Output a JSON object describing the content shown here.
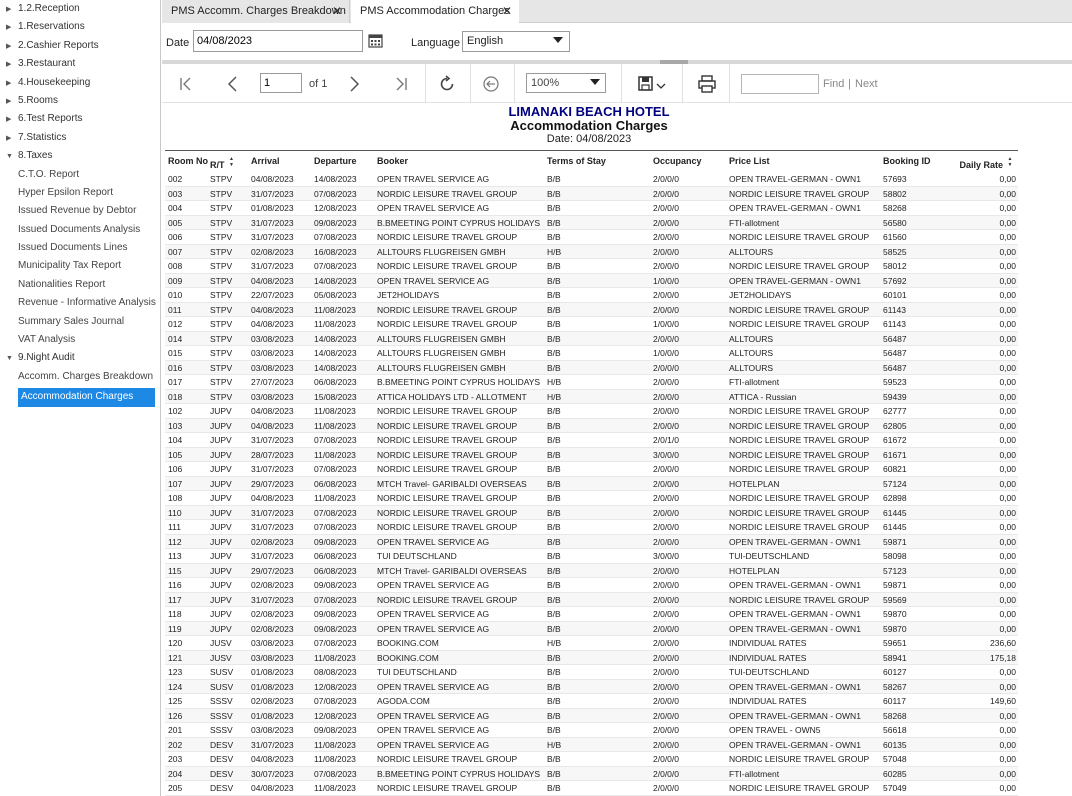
{
  "sidebar": {
    "items": [
      {
        "label": "1.2.Reception",
        "type": "section"
      },
      {
        "label": "1.Reservations",
        "type": "section"
      },
      {
        "label": "2.Cashier Reports",
        "type": "section"
      },
      {
        "label": "3.Restaurant",
        "type": "section"
      },
      {
        "label": "4.Housekeeping",
        "type": "section"
      },
      {
        "label": "5.Rooms",
        "type": "section"
      },
      {
        "label": "6.Test Reports",
        "type": "section"
      },
      {
        "label": "7.Statistics",
        "type": "section"
      },
      {
        "label": "8.Taxes",
        "type": "section-open"
      },
      {
        "label": "C.T.O. Report",
        "type": "child"
      },
      {
        "label": "Hyper Epsilon Report",
        "type": "child"
      },
      {
        "label": "Issued Revenue by Debtor",
        "type": "child"
      },
      {
        "label": "Issued Documents Analysis",
        "type": "child"
      },
      {
        "label": "Issued Documents Lines",
        "type": "child"
      },
      {
        "label": "Municipality Tax Report",
        "type": "child"
      },
      {
        "label": "Nationalities Report",
        "type": "child"
      },
      {
        "label": "Revenue - Informative Analysis",
        "type": "child"
      },
      {
        "label": "Summary Sales Journal",
        "type": "child"
      },
      {
        "label": "VAT Analysis",
        "type": "child"
      },
      {
        "label": "9.Night Audit",
        "type": "section-open"
      },
      {
        "label": "Accomm. Charges Breakdown",
        "type": "child"
      },
      {
        "label": "Accommodation Charges",
        "type": "active"
      }
    ]
  },
  "tabs": [
    {
      "label": "PMS Accomm. Charges Breakdown",
      "close": "✕"
    },
    {
      "label": "PMS Accommodation Charges",
      "close": "✕"
    }
  ],
  "filters": {
    "date_label": "Date",
    "date_value": "04/08/2023",
    "language_label": "Language",
    "language_value": "English"
  },
  "toolbar": {
    "page_value": "1",
    "of_label": "of 1",
    "zoom": "100%",
    "find_label": "Find",
    "separator": "|",
    "next_label": "Next"
  },
  "icons": [
    "first-page-icon",
    "prev-page-icon",
    "next-page-icon",
    "last-page-icon",
    "refresh-icon",
    "back-icon",
    "save-icon",
    "print-icon",
    "calendar-icon"
  ],
  "report": {
    "hotel_name": "LIMANAKI BEACH HOTEL",
    "title": "Accommodation Charges",
    "date_line": "Date: 04/08/2023",
    "columns": [
      "Room No",
      "R/T",
      "Arrival",
      "Departure",
      "Booker",
      "Terms of Stay",
      "Occupancy",
      "Price List",
      "Booking ID",
      "Daily Rate"
    ],
    "rows": [
      [
        "002",
        "STPV",
        "04/08/2023",
        "14/08/2023",
        "OPEN TRAVEL SERVICE AG",
        "B/B",
        "2/0/0/0",
        "OPEN TRAVEL-GERMAN - OWN1",
        "57693",
        "0,00"
      ],
      [
        "003",
        "STPV",
        "31/07/2023",
        "07/08/2023",
        "NORDIC LEISURE TRAVEL GROUP",
        "B/B",
        "2/0/0/0",
        "NORDIC LEISURE TRAVEL GROUP",
        "58802",
        "0,00"
      ],
      [
        "004",
        "STPV",
        "01/08/2023",
        "12/08/2023",
        "OPEN TRAVEL SERVICE AG",
        "B/B",
        "2/0/0/0",
        "OPEN TRAVEL-GERMAN - OWN1",
        "58268",
        "0,00"
      ],
      [
        "005",
        "STPV",
        "31/07/2023",
        "09/08/2023",
        "B.BMEETING POINT CYPRUS HOLIDAYS",
        "B/B",
        "2/0/0/0",
        "FTI-allotment",
        "56580",
        "0,00"
      ],
      [
        "006",
        "STPV",
        "31/07/2023",
        "07/08/2023",
        "NORDIC LEISURE TRAVEL GROUP",
        "B/B",
        "2/0/0/0",
        "NORDIC LEISURE TRAVEL GROUP",
        "61560",
        "0,00"
      ],
      [
        "007",
        "STPV",
        "02/08/2023",
        "16/08/2023",
        "ALLTOURS FLUGREISEN GMBH",
        "H/B",
        "2/0/0/0",
        "ALLTOURS",
        "58525",
        "0,00"
      ],
      [
        "008",
        "STPV",
        "31/07/2023",
        "07/08/2023",
        "NORDIC LEISURE TRAVEL GROUP",
        "B/B",
        "2/0/0/0",
        "NORDIC LEISURE TRAVEL GROUP",
        "58012",
        "0,00"
      ],
      [
        "009",
        "STPV",
        "04/08/2023",
        "14/08/2023",
        "OPEN TRAVEL SERVICE AG",
        "B/B",
        "1/0/0/0",
        "OPEN TRAVEL-GERMAN - OWN1",
        "57692",
        "0,00"
      ],
      [
        "010",
        "STPV",
        "22/07/2023",
        "05/08/2023",
        "JET2HOLIDAYS",
        "B/B",
        "2/0/0/0",
        "JET2HOLIDAYS",
        "60101",
        "0,00"
      ],
      [
        "011",
        "STPV",
        "04/08/2023",
        "11/08/2023",
        "NORDIC LEISURE TRAVEL GROUP",
        "B/B",
        "2/0/0/0",
        "NORDIC LEISURE TRAVEL GROUP",
        "61143",
        "0,00"
      ],
      [
        "012",
        "STPV",
        "04/08/2023",
        "11/08/2023",
        "NORDIC LEISURE TRAVEL GROUP",
        "B/B",
        "1/0/0/0",
        "NORDIC LEISURE TRAVEL GROUP",
        "61143",
        "0,00"
      ],
      [
        "014",
        "STPV",
        "03/08/2023",
        "14/08/2023",
        "ALLTOURS FLUGREISEN GMBH",
        "B/B",
        "2/0/0/0",
        "ALLTOURS",
        "56487",
        "0,00"
      ],
      [
        "015",
        "STPV",
        "03/08/2023",
        "14/08/2023",
        "ALLTOURS FLUGREISEN GMBH",
        "B/B",
        "1/0/0/0",
        "ALLTOURS",
        "56487",
        "0,00"
      ],
      [
        "016",
        "STPV",
        "03/08/2023",
        "14/08/2023",
        "ALLTOURS FLUGREISEN GMBH",
        "B/B",
        "2/0/0/0",
        "ALLTOURS",
        "56487",
        "0,00"
      ],
      [
        "017",
        "STPV",
        "27/07/2023",
        "06/08/2023",
        "B.BMEETING POINT CYPRUS HOLIDAYS",
        "H/B",
        "2/0/0/0",
        "FTI-allotment",
        "59523",
        "0,00"
      ],
      [
        "018",
        "STPV",
        "03/08/2023",
        "15/08/2023",
        "ATTICA HOLIDAYS LTD - ALLOTMENT",
        "H/B",
        "2/0/0/0",
        "ATTICA - Russian",
        "59439",
        "0,00"
      ],
      [
        "102",
        "JUPV",
        "04/08/2023",
        "11/08/2023",
        "NORDIC LEISURE TRAVEL GROUP",
        "B/B",
        "2/0/0/0",
        "NORDIC LEISURE TRAVEL GROUP",
        "62777",
        "0,00"
      ],
      [
        "103",
        "JUPV",
        "04/08/2023",
        "11/08/2023",
        "NORDIC LEISURE TRAVEL GROUP",
        "B/B",
        "2/0/0/0",
        "NORDIC LEISURE TRAVEL GROUP",
        "62805",
        "0,00"
      ],
      [
        "104",
        "JUPV",
        "31/07/2023",
        "07/08/2023",
        "NORDIC LEISURE TRAVEL GROUP",
        "B/B",
        "2/0/1/0",
        "NORDIC LEISURE TRAVEL GROUP",
        "61672",
        "0,00"
      ],
      [
        "105",
        "JUPV",
        "28/07/2023",
        "11/08/2023",
        "NORDIC LEISURE TRAVEL GROUP",
        "B/B",
        "3/0/0/0",
        "NORDIC LEISURE TRAVEL GROUP",
        "61671",
        "0,00"
      ],
      [
        "106",
        "JUPV",
        "31/07/2023",
        "07/08/2023",
        "NORDIC LEISURE TRAVEL GROUP",
        "B/B",
        "2/0/0/0",
        "NORDIC LEISURE TRAVEL GROUP",
        "60821",
        "0,00"
      ],
      [
        "107",
        "JUPV",
        "29/07/2023",
        "06/08/2023",
        "MTCH Travel- GARIBALDI OVERSEAS",
        "B/B",
        "2/0/0/0",
        "HOTELPLAN",
        "57124",
        "0,00"
      ],
      [
        "108",
        "JUPV",
        "04/08/2023",
        "11/08/2023",
        "NORDIC LEISURE TRAVEL GROUP",
        "B/B",
        "2/0/0/0",
        "NORDIC LEISURE TRAVEL GROUP",
        "62898",
        "0,00"
      ],
      [
        "110",
        "JUPV",
        "31/07/2023",
        "07/08/2023",
        "NORDIC LEISURE TRAVEL GROUP",
        "B/B",
        "2/0/0/0",
        "NORDIC LEISURE TRAVEL GROUP",
        "61445",
        "0,00"
      ],
      [
        "111",
        "JUPV",
        "31/07/2023",
        "07/08/2023",
        "NORDIC LEISURE TRAVEL GROUP",
        "B/B",
        "2/0/0/0",
        "NORDIC LEISURE TRAVEL GROUP",
        "61445",
        "0,00"
      ],
      [
        "112",
        "JUPV",
        "02/08/2023",
        "09/08/2023",
        "OPEN TRAVEL SERVICE AG",
        "B/B",
        "2/0/0/0",
        "OPEN TRAVEL-GERMAN - OWN1",
        "59871",
        "0,00"
      ],
      [
        "113",
        "JUPV",
        "31/07/2023",
        "06/08/2023",
        "TUI DEUTSCHLAND",
        "B/B",
        "3/0/0/0",
        "TUI-DEUTSCHLAND",
        "58098",
        "0,00"
      ],
      [
        "115",
        "JUPV",
        "29/07/2023",
        "06/08/2023",
        "MTCH Travel- GARIBALDI OVERSEAS",
        "B/B",
        "2/0/0/0",
        "HOTELPLAN",
        "57123",
        "0,00"
      ],
      [
        "116",
        "JUPV",
        "02/08/2023",
        "09/08/2023",
        "OPEN TRAVEL SERVICE AG",
        "B/B",
        "2/0/0/0",
        "OPEN TRAVEL-GERMAN - OWN1",
        "59871",
        "0,00"
      ],
      [
        "117",
        "JUPV",
        "31/07/2023",
        "07/08/2023",
        "NORDIC LEISURE TRAVEL GROUP",
        "B/B",
        "2/0/0/0",
        "NORDIC LEISURE TRAVEL GROUP",
        "59569",
        "0,00"
      ],
      [
        "118",
        "JUPV",
        "02/08/2023",
        "09/08/2023",
        "OPEN TRAVEL SERVICE AG",
        "B/B",
        "2/0/0/0",
        "OPEN TRAVEL-GERMAN - OWN1",
        "59870",
        "0,00"
      ],
      [
        "119",
        "JUPV",
        "02/08/2023",
        "09/08/2023",
        "OPEN TRAVEL SERVICE AG",
        "B/B",
        "2/0/0/0",
        "OPEN TRAVEL-GERMAN - OWN1",
        "59870",
        "0,00"
      ],
      [
        "120",
        "JUSV",
        "03/08/2023",
        "07/08/2023",
        "BOOKING.COM",
        "H/B",
        "2/0/0/0",
        "INDIVIDUAL RATES",
        "59651",
        "236,60"
      ],
      [
        "121",
        "JUSV",
        "03/08/2023",
        "11/08/2023",
        "BOOKING.COM",
        "B/B",
        "2/0/0/0",
        "INDIVIDUAL RATES",
        "58941",
        "175,18"
      ],
      [
        "123",
        "SUSV",
        "01/08/2023",
        "08/08/2023",
        "TUI DEUTSCHLAND",
        "B/B",
        "2/0/0/0",
        "TUI-DEUTSCHLAND",
        "60127",
        "0,00"
      ],
      [
        "124",
        "SUSV",
        "01/08/2023",
        "12/08/2023",
        "OPEN TRAVEL SERVICE AG",
        "B/B",
        "2/0/0/0",
        "OPEN TRAVEL-GERMAN - OWN1",
        "58267",
        "0,00"
      ],
      [
        "125",
        "SSSV",
        "02/08/2023",
        "07/08/2023",
        "AGODA.COM",
        "B/B",
        "2/0/0/0",
        "INDIVIDUAL RATES",
        "60117",
        "149,60"
      ],
      [
        "126",
        "SSSV",
        "01/08/2023",
        "12/08/2023",
        "OPEN TRAVEL SERVICE AG",
        "B/B",
        "2/0/0/0",
        "OPEN TRAVEL-GERMAN - OWN1",
        "58268",
        "0,00"
      ],
      [
        "201",
        "SSSV",
        "03/08/2023",
        "09/08/2023",
        "OPEN TRAVEL SERVICE AG",
        "B/B",
        "2/0/0/0",
        "OPEN TRAVEL - OWN5",
        "56618",
        "0,00"
      ],
      [
        "202",
        "DESV",
        "31/07/2023",
        "11/08/2023",
        "OPEN TRAVEL SERVICE AG",
        "H/B",
        "2/0/0/0",
        "OPEN TRAVEL-GERMAN - OWN1",
        "60135",
        "0,00"
      ],
      [
        "203",
        "DESV",
        "04/08/2023",
        "11/08/2023",
        "NORDIC LEISURE TRAVEL GROUP",
        "B/B",
        "2/0/0/0",
        "NORDIC LEISURE TRAVEL GROUP",
        "57048",
        "0,00"
      ],
      [
        "204",
        "DESV",
        "30/07/2023",
        "07/08/2023",
        "B.BMEETING POINT CYPRUS HOLIDAYS",
        "B/B",
        "2/0/0/0",
        "FTI-allotment",
        "60285",
        "0,00"
      ],
      [
        "205",
        "DESV",
        "04/08/2023",
        "11/08/2023",
        "NORDIC LEISURE TRAVEL GROUP",
        "B/B",
        "2/0/0/0",
        "NORDIC LEISURE TRAVEL GROUP",
        "57049",
        "0,00"
      ]
    ]
  }
}
